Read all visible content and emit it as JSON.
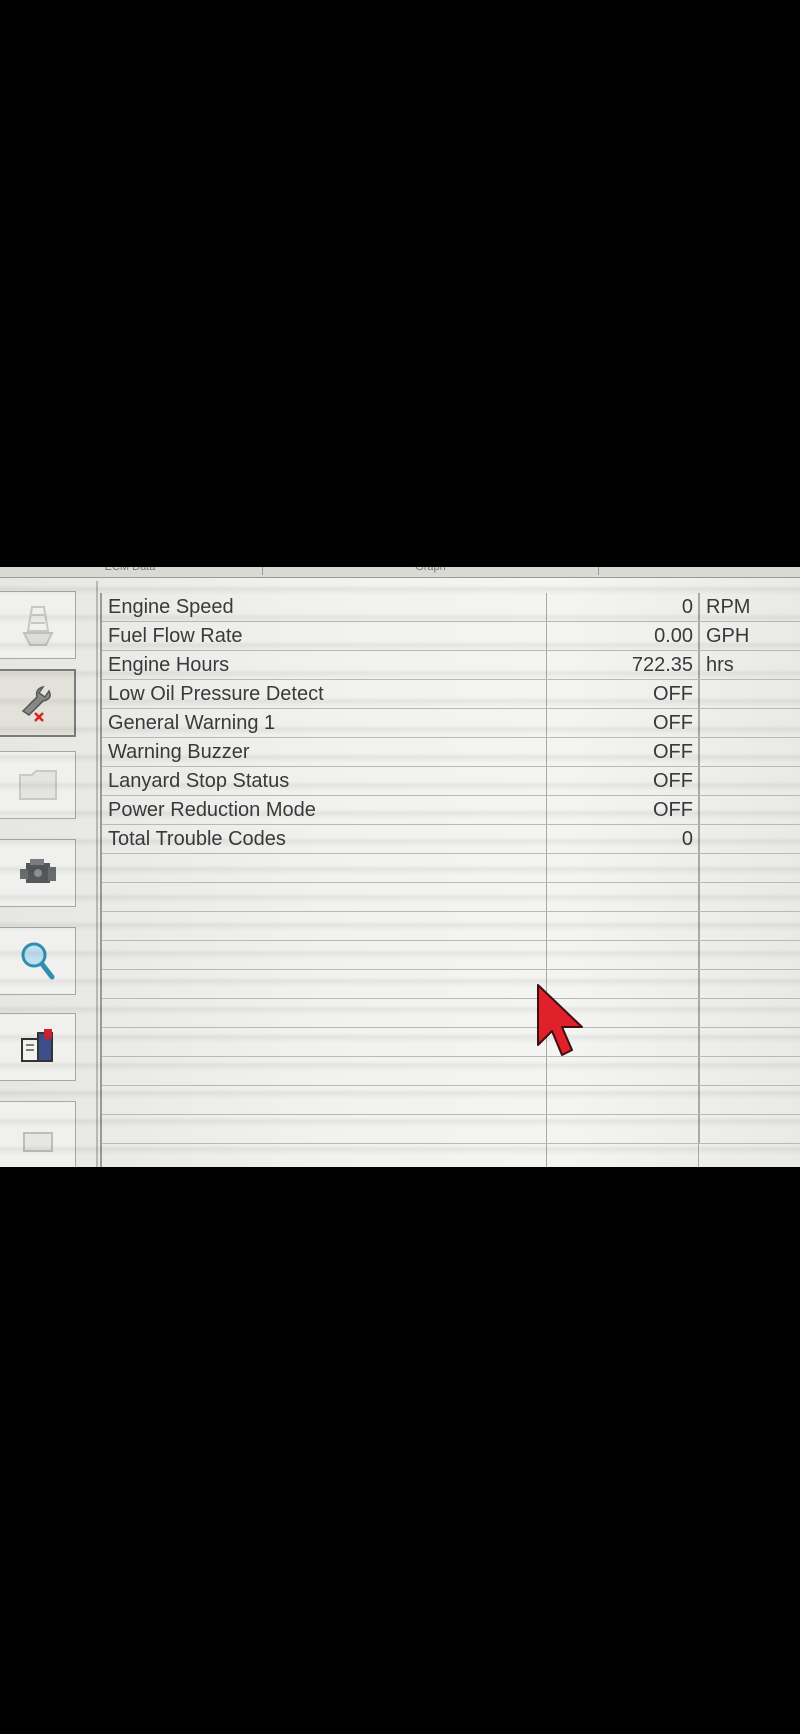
{
  "tabs": [
    "ECM Data",
    "Graph",
    ""
  ],
  "toolbar": {
    "items": [
      {
        "name": "boat-icon",
        "active": false
      },
      {
        "name": "wrench-fault-icon",
        "active": true
      },
      {
        "name": "folder-icon",
        "active": false
      },
      {
        "name": "engine-icon",
        "active": false
      },
      {
        "name": "magnifier-icon",
        "active": false
      },
      {
        "name": "manual-book-icon",
        "active": false
      },
      {
        "name": "document-icon",
        "active": false
      }
    ]
  },
  "rows": [
    {
      "label": "Engine Speed",
      "value": "0",
      "unit": "RPM"
    },
    {
      "label": "Fuel Flow Rate",
      "value": "0.00",
      "unit": "GPH"
    },
    {
      "label": "Engine Hours",
      "value": "722.35",
      "unit": "hrs"
    },
    {
      "label": "Low Oil Pressure Detect",
      "value": "OFF",
      "unit": ""
    },
    {
      "label": "General Warning 1",
      "value": "OFF",
      "unit": ""
    },
    {
      "label": "Warning Buzzer",
      "value": "OFF",
      "unit": ""
    },
    {
      "label": "Lanyard Stop Status",
      "value": "OFF",
      "unit": ""
    },
    {
      "label": "Power Reduction Mode",
      "value": "OFF",
      "unit": ""
    },
    {
      "label": "Total Trouble Codes",
      "value": "0",
      "unit": ""
    },
    {
      "label": "",
      "value": "",
      "unit": ""
    },
    {
      "label": "",
      "value": "",
      "unit": ""
    },
    {
      "label": "",
      "value": "",
      "unit": ""
    },
    {
      "label": "",
      "value": "",
      "unit": ""
    },
    {
      "label": "",
      "value": "",
      "unit": ""
    },
    {
      "label": "",
      "value": "",
      "unit": ""
    },
    {
      "label": "",
      "value": "",
      "unit": ""
    },
    {
      "label": "",
      "value": "",
      "unit": ""
    },
    {
      "label": "",
      "value": "",
      "unit": ""
    },
    {
      "label": "",
      "value": "",
      "unit": ""
    }
  ],
  "colors": {
    "cursor": "#e0202a",
    "text": "#3a3a3a",
    "background": "#f1f1ef"
  }
}
